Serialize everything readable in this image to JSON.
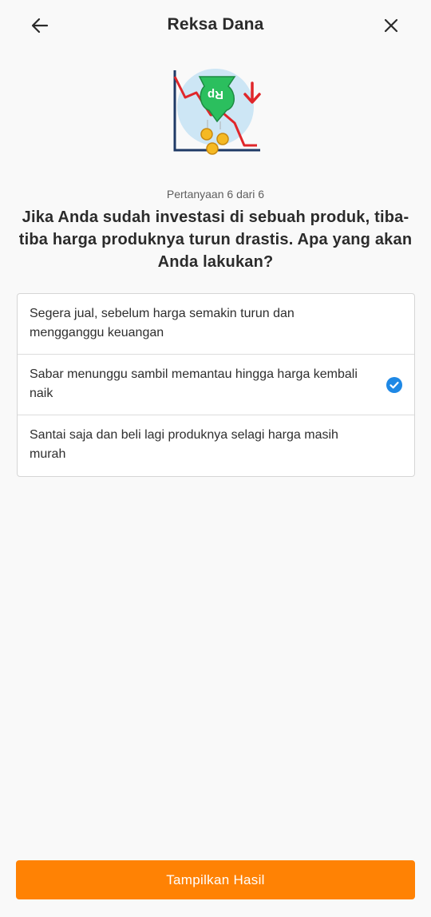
{
  "header": {
    "title": "Reksa Dana",
    "back_icon": "arrow-left-icon",
    "close_icon": "close-icon"
  },
  "illustration": {
    "icon": "falling-price-chart-illustration",
    "badge_text": "Rp"
  },
  "question": {
    "counter": "Pertanyaan 6 dari 6",
    "text": "Jika Anda sudah investasi di sebuah produk, tiba-tiba harga produknya turun drastis. Apa yang akan Anda lakukan?"
  },
  "options": [
    {
      "label": "Segera jual, sebelum harga semakin turun dan mengganggu keuangan",
      "selected": false
    },
    {
      "label": "Sabar menunggu sambil memantau hingga harga kembali naik",
      "selected": true
    },
    {
      "label": "Santai saja dan beli lagi produknya selagi harga masih murah",
      "selected": false
    }
  ],
  "footer": {
    "button_label": "Tampilkan Hasil"
  },
  "colors": {
    "accent": "#ff8204",
    "check": "#1e88e5",
    "illustration_red": "#e0262a",
    "illustration_green": "#2bbf5e",
    "illustration_coin": "#f5b923"
  }
}
